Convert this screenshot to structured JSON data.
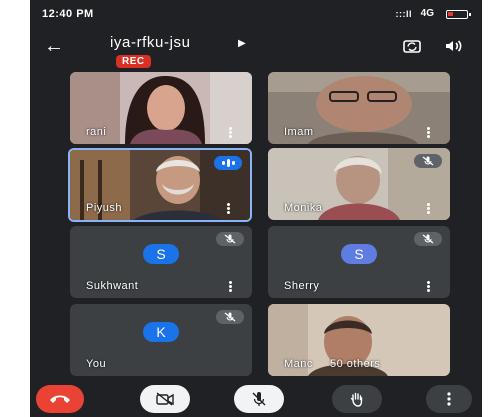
{
  "status_bar": {
    "time": "12:40 PM",
    "signal": ":::ll",
    "network": "4G",
    "battery_color": "#e53935"
  },
  "header": {
    "meeting_code": "iya-rfku-jsu",
    "recording_badge": "REC",
    "icons": [
      "back-arrow-icon",
      "camera-switch-icon",
      "speaker-icon"
    ]
  },
  "participants": [
    {
      "name": "rani",
      "type": "video"
    },
    {
      "name": "Imam",
      "type": "video"
    },
    {
      "name": "Piyush",
      "type": "video",
      "speaking": true
    },
    {
      "name": "Monika",
      "type": "video",
      "muted": true
    },
    {
      "name": "Sukhwant",
      "type": "avatar",
      "initial": "S",
      "avatar_color": "#1a73e8",
      "muted": true
    },
    {
      "name": "Sherry",
      "type": "avatar",
      "initial": "S",
      "avatar_color": "#5e7ce2",
      "muted": true
    },
    {
      "name": "You",
      "type": "avatar",
      "initial": "K",
      "avatar_color": "#1a73e8",
      "muted": true
    },
    {
      "name": "Manc",
      "type": "video",
      "others_label": "50 others"
    }
  ],
  "controls": {
    "hangup_color": "#ea4335",
    "buttons": [
      "hangup-icon",
      "camera-off-icon",
      "mic-off-icon",
      "raise-hand-icon",
      "more-options-icon"
    ]
  }
}
